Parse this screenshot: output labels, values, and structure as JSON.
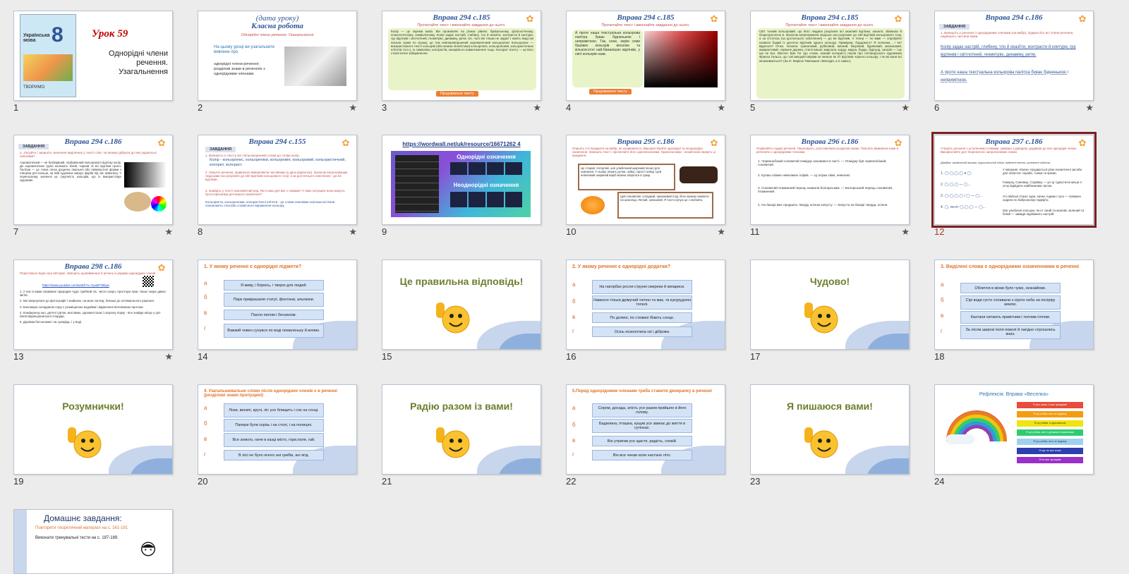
{
  "slides": {
    "s1": {
      "num": "1",
      "lesson": "Урок  59",
      "topic": "Однорідні члени речення. Узагальнення",
      "book_title": "Українська мова",
      "book_grade": "8",
      "book_footer": "ТВОРИМО"
    },
    "s2": {
      "num": "2",
      "title": "(дата уроку)",
      "title2": "Класна  робота",
      "subtitle": "Однорідні члени речення. Узагальнення",
      "lead": "На цьому уроці ви узагальните вивчене про",
      "items": [
        "однорідні члени речення;",
        "розділові знаки в реченнях з однорідними членами."
      ]
    },
    "s3": {
      "num": "3",
      "title": "Вправа 294  с.185",
      "subtitle": "Прочитайте текст і виконайте завдання до нього.",
      "text": "Колір — це окрема мова. Він промовляє на різних рівнях: буквальному, фізіологічному, психологічному, символічному. Колір задає настрій, глибину, тло й оказіїти, контрасти й контури, гру відтінків і світлотіней, геометрію, динаміку, ритм. Ох, чого він тільки не задає! І навіть якщо ви писали сірим по сірому, це теж невперевершений ахроматичний кольоропис! Кольоропис — використання в тексті кольорів (або можна лінгвістики) кольоропис, кольорономія, кольористичних епітетів та ін.), їх символіки, контрастів, емоційного навантаження тощо. Колорит тексту — це його стилістичне забарвлення.",
      "button": "Продовження тексту"
    },
    "s4": {
      "num": "4",
      "title": "Вправа 294  с.185",
      "subtitle": "Прочитайте текст і виконайте завдання до нього.",
      "text": "А проте наша текстуальна кольорова палітра буває бідненькою і непримітною. Так, ноне, окрім семи базових кольорів веселки та кількохсотні най-бажаніших відтінків, у світі кольорів назв.",
      "button": "Продовження тексту"
    },
    "s5": {
      "num": "5",
      "title": "Вправа 294  с.185",
      "subtitle": "Прочитайте текст і виконайте завдання до нього.",
      "text": "Світ тонкий кольоровий, що його людина розрізняє всі можливі відтінки, нахиля, збивково й безрезультатно 6. Загалом натренування людське око розрізняє до 150 відтінків кольорового тону, а за сітлотою (за достатнього освітлення) — до 64 відтінків. А тепер — по вам! — спробуйте назвати бодай із десяток відтінків одного кольору. Приміром, бордового? Я почекаю... І як? Вдалося? Отже, поіхали: гранатовий, рубіновий, винний, багряний, буряковий, малиновий, амарантовий, червоне дерево, стиглі вишні, марсала, кордо, марун, бордо, бургунд, сангрія — і це ще не все. Вінсент Ван Гог (до слова, знаний колорист) писав про голландського художника Франса Гальса, що той використовував не менше як 27 відтінків чорного кольору. І як ви вони всі якоизивоються? (За О. Марією Тимчишин «Мелодія, а я сама»)."
    },
    "s6": {
      "num": "6",
      "title": "Вправа 294  с.186",
      "tag": "ЗАВДАННЯ",
      "text1": "1. Випишіть 2 речення з однорідними членами (на вибір), підкресліть всі члени речення, надпишіть частини мови.",
      "text2": "Колір задає настрій, глибину, тло й оказіїти, контрасти й контури, гру відтінків і світлотіней, геометрію, динаміку, ритм.",
      "text3": "А проте наша текстуальна кольорова палітра буває бідненькою і непримітною."
    },
    "s7": {
      "num": "7",
      "title": "Вправа 294  с.186",
      "tag": "ЗАВДАННЯ",
      "task": "2. З'ясуйте і запишіть значення виділених у тексті слів. Чи можна дібрати до них українські синоніми?",
      "text": "Ахроматичний — не безбарвний, позбавлений кольорового відтінку колір. До ахроматичних групи належать білий, чорний та всі відтінки сірого. Палітра — це тонка легка дощечка овальної або прямокутної форми з отвором для пальця, на якій художник змішує фарби під час живопису. У переносному значенні це сукупність кольорів, що їх використовує художник."
    },
    "s8": {
      "num": "8",
      "title": "Вправа 294  с.155",
      "tag": "ЗАВДАННЯ",
      "t1": "1. Випишіть із тексту всі спільнокореневі слова до слова колір.",
      "t2": "Колір - кольоропис, кольоритики, кольоромія, кольоровий, кольористичний, колорит, колорист.",
      "t3": "2. Озвучте речення, правильно вимовляючи числівники (у двох варіантах). Загалом натренованим людським око розрізняє до 150 відтінків кольорового тону; а за достатнього освітлення - до 64 відтінків.",
      "t4": "3. Знайдіть у тексті синонімічний ряд. Які слова для вас є новими? У яких ситуаціях вони можуть бути корисними для вашого мовлення?",
      "t5": "Кольористи, кольорономи, колористичні епітети - це слова-синоніми оскільки всі вони позначають способи словесного вираження кольору."
    },
    "s9": {
      "num": "9",
      "link": "https://wordwall.net/uk/resource/16671262 4",
      "h1": "Однорідні означення",
      "h2": "Неоднорідні означення"
    },
    "s10": {
      "num": "10",
      "title": "Вправа 295 с.186",
      "task": "Опишіть 2-3 предмети на вибір, не називаючи їх. Використовуйте однорідні та неоднорідні означення. Запишіть текст і прочитайте його однокласникам. Однокласники - нехай вони назвуть ці предмети.",
      "p1": "Це старий, потертий, але улюблений шкіряний пенал для навчання. У ньому лежать ручки, олівці і прості олівці. Цей невеликий шкіряний виріб можна зберігати в сумці.",
      "p2": "Цей соковитий, солодкий, оранжевий плід. Його можна поміняти на шоколад. Легкий, запашний. Я часто купую це з любов'ю."
    },
    "s11": {
      "num": "11",
      "title": "Вправа 296 с.186",
      "task": "Порівняйте подані речення. Перепишіть, розставляючи розділові знаки. Поясніть вживання коми в реченнях з однорідними членами.",
      "l1": "1. Червонобокий соковитий помідор заховався в листі. — Помідор був червонобокий, соковитий.",
      "l2": "2. Купиш свіжих невеликих огірків. — Ці огірки свіжі, невеликі.",
      "l3": "3. Соковитий ятаминний перець назвали болгарським. — Болгарський перець соковитий, ятаминний.",
      "l4": "4. На базарі вже продають тверду осінню капусту. — Капуста на базарі тверда, осіння."
    },
    "s12": {
      "num": "12",
      "title": "Вправа 297 с.186",
      "task": "Утворіть речення з усталеннми словами, уживши з доводом, додавши до них однорідні члени. Використайте для творення всі запропоновані схеми.",
      "legend": "Довідка: засмічений вашим, туристичний обозі, виділені тепло, утеплені чоботи.",
      "r1": "У магазині «Ємок» продаються різні косметичні засоби для обличчя: скраби, тоніки та креми.",
      "r2": "Говерлу, Синевир, Софіївку — усі ці туристичні місця я хочу відвідати найближчим часом.",
      "r3": "Усі свійські птахи: кури, качки, індики і гуси — поважно ходили по бабусиному подвір'ю.",
      "r4": "Мої улюблені кольори, як-от синій та жовтий, зелений та білий — завжди піднімають настрій."
    },
    "s13": {
      "num": "13",
      "title": "Вправа 298 с.186",
      "task": "Перегляньте відео про вікторин. Запишіть щонайменше 5 речень із рядами однорідних членів.",
      "link": "https://www.youtube.com/watch?v=7yxaIP78hyw",
      "lines": [
        "1. У нас із вами справжнє природне чудо: грибний ліс, чисте озеро, простори луки, тиша і море диких квітів.",
        "2. Ми звернулися до фотографії і знайшли, на мою погляд, близькі до оптимального рішення.",
        "3. Боклажую складовою пору є розміщеною водойми і відвеленні вілляковою протоки.",
        "4. Конференц-зал, дитячі гуртки, виставки, одноместошкі і охорону порку - все знайде місце у цієї багатофункціональної споруди.",
        "5. Доріжки босоножки і на сухарідь, і у воді."
      ]
    },
    "s14": {
      "num": "14",
      "q": "1. У якому реченні є однорідні підмети?",
      "opts": [
        "Я живу, і борюсь, і творю для людей.",
        "Парк прикрашали статуї, фонтани, альтанки.",
        "Пахло пилом і бензином.",
        "Важкий човен сунувся по воді помаленьку й мляво."
      ],
      "letters": [
        "а",
        "б",
        "в",
        "г"
      ]
    },
    "s15": {
      "num": "15",
      "text": "Це правильна відповідь!"
    },
    "s16": {
      "num": "16",
      "q": "2. У якому реченні є однорідні додатки?",
      "opts": [
        "На пагорбах росли стрункі смереки й кипариси.",
        "Навколо тільки дрімучий тютюн та мак, та кукурудзяні тополі.",
        "По долині, по стежині біжить сонце.",
        "Осінь позолотила гаї і діброви."
      ],
      "letters": [
        "а",
        "б",
        "в",
        "г"
      ]
    },
    "s17": {
      "num": "17",
      "text": "Чудово!"
    },
    "s18": {
      "num": "18",
      "q": "3. Виділені слова є однорідними означеннями в реченні",
      "opts": [
        "Обличчя в жінки було чуже, незнайоме.",
        "Сірі води густо спливали з сірого неба на посіріру землю.",
        "Кахтани хитають привітним і теплим гіллям.",
        "За лісом широкі поля поволі й лагідно спускались вниз."
      ],
      "letters": [
        "а",
        "б",
        "в",
        "г"
      ]
    },
    "s19": {
      "num": "19",
      "text": "Розумнички!"
    },
    "s20": {
      "num": "20",
      "q": "4. Узагальнювальне слово після однорідних членів є в реченні (розділові знаки пропущені)",
      "opts": [
        "Лози, висипі, кручі, ліс усе блищить і сяє на сонці.",
        "Папери були скрізь і на столі, і на полицях.",
        "Все зникло, наче в казці місто, гори,поле, гай.",
        "В лісі не було нічого ані грибів, ані ягід."
      ],
      "letters": [
        "а",
        "б",
        "в",
        "г"
      ]
    },
    "s21": {
      "num": "21",
      "text": "Радію разом із вами!"
    },
    "s22": {
      "num": "22",
      "q": "5.Перед однорідними членами треба ставити двокрапку в реченні",
      "opts": [
        "Сором, досада, злість усе разом прийшло в його голову.",
        "Бадилина, пташка, кущик усе звикає до життя в сутінках.",
        "Він утратив усе щастя, радість, спокій.",
        "Він все чекав коли настане літо."
      ],
      "letters": [
        "а",
        "б",
        "в",
        "г"
      ]
    },
    "s23": {
      "num": "23",
      "text": "Я пишаюся вами!"
    },
    "s24": {
      "num": "24",
      "title": "Рефлексія. Вправа «Веселка»",
      "bars": [
        "Я все знаю, я все зрозумів!",
        "Я це робив, але не відразу",
        "Я це робив, із допомогою",
        "Я це робив, але з деякими помилками",
        "Я це робив, але не відразу",
        "Я ще не все знаю",
        "Я не все зрозумів"
      ]
    },
    "s25": {
      "title": "Домашнє завдання:",
      "l1": "Повторити теоретичний матеріал на с. 161-191",
      "l2": "Виконати тренувальні тести на с. 187-189."
    }
  },
  "star": "★",
  "colors": {
    "accent": "#2f5597",
    "orange": "#ed7d31",
    "selected": "#7c1f1f"
  }
}
